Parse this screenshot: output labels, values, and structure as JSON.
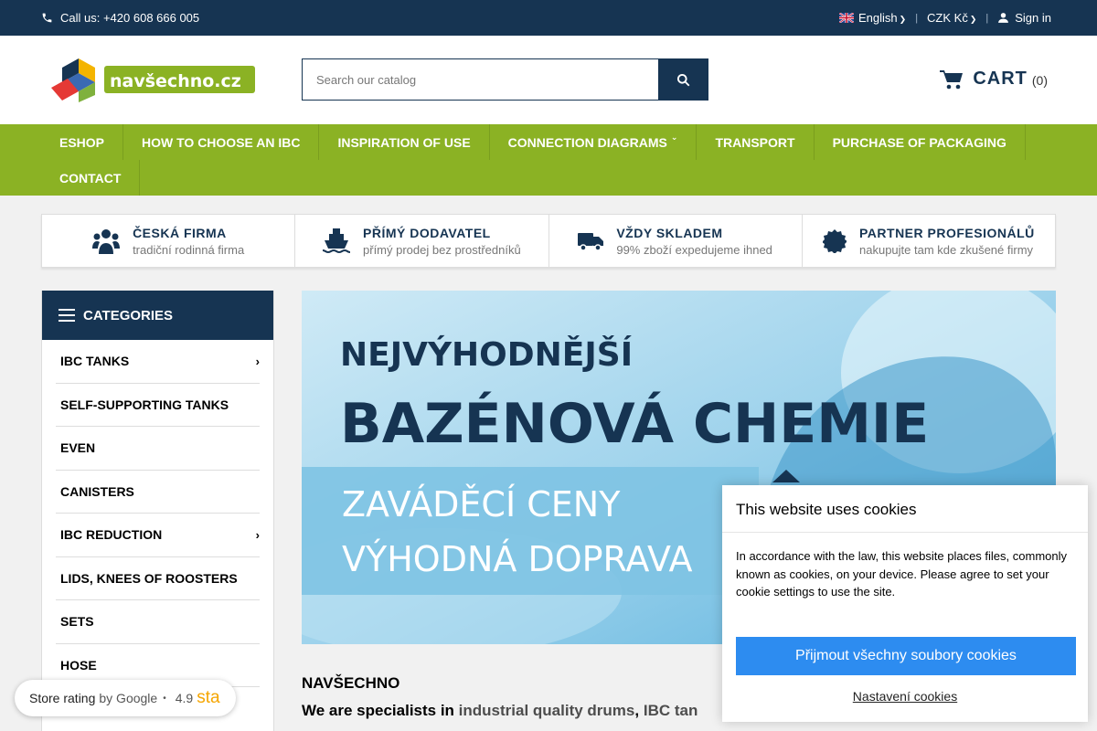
{
  "topbar": {
    "call": "Call us: +420 608 666 005",
    "language": "English",
    "currency": "CZK Kč",
    "signin": "Sign in"
  },
  "header": {
    "logo_text": "navšechno.cz",
    "search_placeholder": "Search our catalog",
    "cart_label": "CART",
    "cart_count": "(0)"
  },
  "nav": {
    "items": [
      "ESHOP",
      "HOW TO CHOOSE AN IBC",
      "INSPIRATION OF USE",
      "CONNECTION DIAGRAMS",
      "TRANSPORT",
      "PURCHASE OF PACKAGING",
      "CONTACT"
    ]
  },
  "usp": [
    {
      "title": "ČESKÁ FIRMA",
      "sub": "tradiční rodinná firma",
      "icon": "users-icon"
    },
    {
      "title": "PŘÍMÝ DODAVATEL",
      "sub": "přímý prodej bez prostředníků",
      "icon": "ship-icon"
    },
    {
      "title": "VŽDY SKLADEM",
      "sub": "99% zboží expedujeme ihned",
      "icon": "truck-icon"
    },
    {
      "title": "PARTNER PROFESIONÁLŮ",
      "sub": "nakupujte tam kde zkušené firmy",
      "icon": "badge-icon"
    }
  ],
  "categories": {
    "title": "CATEGORIES",
    "items": [
      {
        "label": "IBC TANKS",
        "arrow": "›"
      },
      {
        "label": "SELF-SUPPORTING TANKS",
        "arrow": ""
      },
      {
        "label": "EVEN",
        "arrow": ""
      },
      {
        "label": "CANISTERS",
        "arrow": ""
      },
      {
        "label": "IBC REDUCTION",
        "arrow": "›"
      },
      {
        "label": "LIDS, KNEES OF ROOSTERS",
        "arrow": ""
      },
      {
        "label": "SETS",
        "arrow": ""
      },
      {
        "label": "HOSE",
        "arrow": ""
      }
    ]
  },
  "banner": {
    "line1": "NEJVÝHODNĚJŠÍ",
    "line2": "BAZÉNOVÁ CHEMIE",
    "line3": "ZAVÁDĚCÍ CENY",
    "line4": "VÝHODNÁ DOPRAVA"
  },
  "about": {
    "heading": "NAVŠECHNO",
    "lead": "We are specialists in",
    "link1": "industrial quality drums",
    "comma": ",",
    "link2": "IBC tan"
  },
  "cookie": {
    "title": "This website uses cookies",
    "body": "In accordance with the law, this website places files, commonly known as cookies, on your device. Please agree to set your cookie settings to use the site.",
    "accept": "Přijmout všechny soubory cookies",
    "settings": "Nastavení cookies"
  },
  "rating": {
    "label": "Store rating",
    "by": "by Google",
    "dot": "•",
    "score": "4.9",
    "stars": "sta"
  },
  "colors": {
    "navy": "#163452",
    "green": "#8bb224",
    "accept_blue": "#2d8cf0"
  }
}
